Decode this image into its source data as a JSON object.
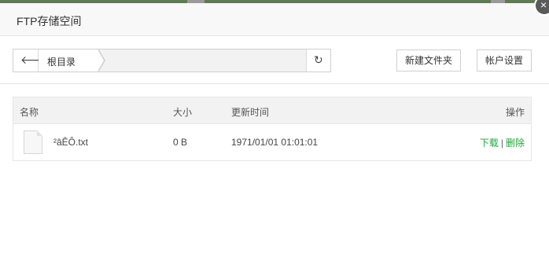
{
  "dialog": {
    "title": "FTP存储空间",
    "close_glyph": "×"
  },
  "toolbar": {
    "back_icon": "arrow-left-icon",
    "breadcrumb_root": "根目录",
    "refresh_icon": "refresh-icon",
    "new_folder_label": "新建文件夹",
    "account_settings_label": "帐户设置"
  },
  "table": {
    "headers": {
      "name": "名称",
      "size": "大小",
      "time": "更新时间",
      "operation": "操作"
    },
    "rows": [
      {
        "icon": "file-icon",
        "name": "²âÊÔ.txt",
        "size": "0 B",
        "time": "1971/01/01 01:01:01",
        "download": "下载",
        "separator": "|",
        "delete": "删除"
      }
    ]
  },
  "colors": {
    "accent_green": "#20a53a",
    "header_bg": "#f8f8f8",
    "table_head_bg": "#f2f2f2"
  }
}
